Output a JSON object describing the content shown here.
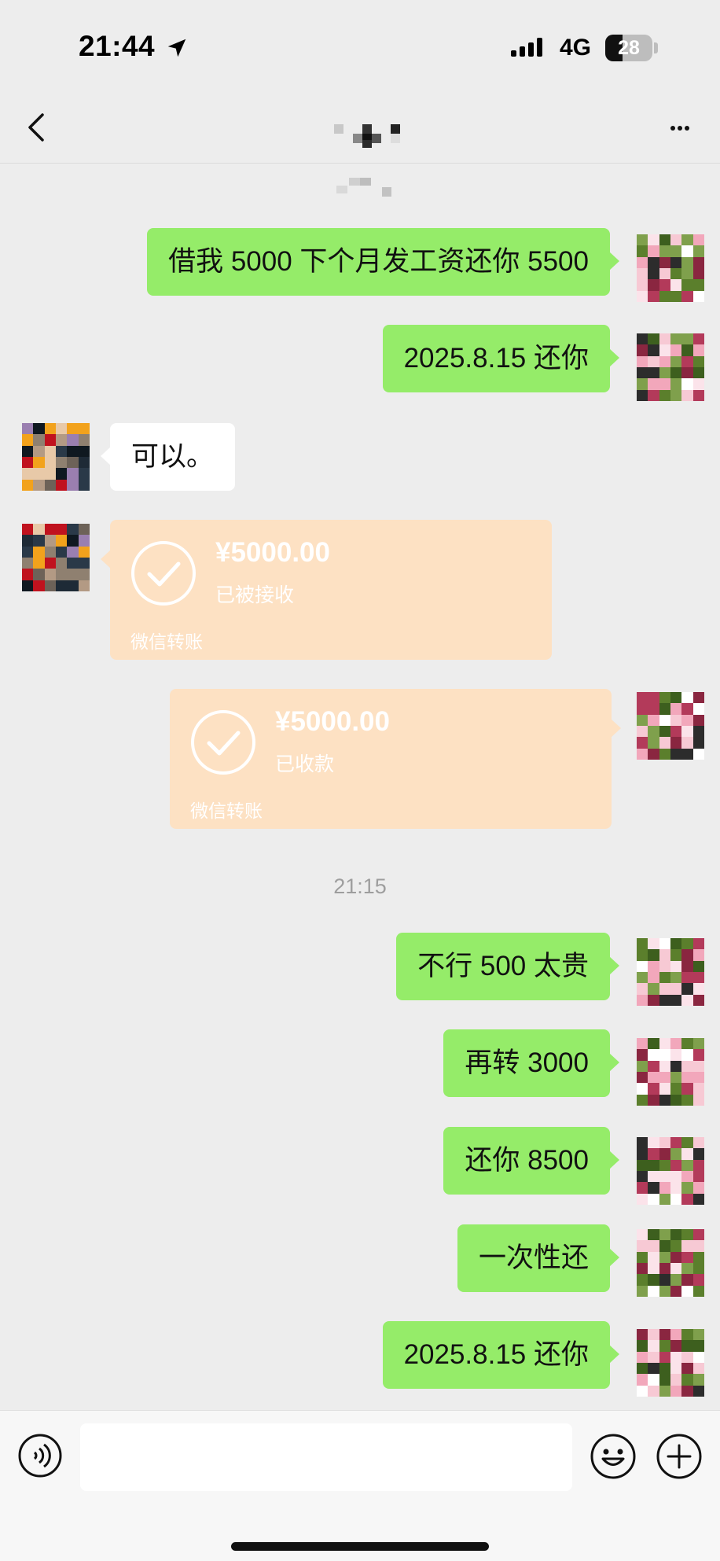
{
  "status_bar": {
    "time": "21:44",
    "network": "4G",
    "battery": "28",
    "icons": [
      "location-arrow-icon",
      "signal-icon",
      "battery-icon"
    ]
  },
  "nav": {
    "back_icon": "chevron-left-icon",
    "more_icon": "more-icon"
  },
  "messages": [
    {
      "side": "me",
      "text": "借我 5000 下个月发工资还你 5500"
    },
    {
      "side": "me",
      "text": "2025.8.15 还你"
    },
    {
      "side": "them",
      "text": "可以。"
    },
    {
      "side": "them",
      "type": "transfer",
      "amount": "¥5000.00",
      "status": "已被接收",
      "footer": "微信转账"
    },
    {
      "side": "me",
      "type": "transfer",
      "amount": "¥5000.00",
      "status": "已收款",
      "footer": "微信转账"
    },
    {
      "type": "timestamp",
      "text": "21:15"
    },
    {
      "side": "me",
      "text": "不行 500 太贵"
    },
    {
      "side": "me",
      "text": "再转 3000"
    },
    {
      "side": "me",
      "text": "还你 8500"
    },
    {
      "side": "me",
      "text": "一次性还"
    },
    {
      "side": "me",
      "text": "2025.8.15 还你"
    }
  ],
  "input_bar": {
    "placeholder": "",
    "icons": [
      "voice-icon",
      "emoji-icon",
      "plus-icon"
    ]
  },
  "colors": {
    "my_bubble": "#95ec69",
    "their_bubble": "#ffffff",
    "transfer_card": "#fde1c3",
    "background": "#ededed"
  }
}
